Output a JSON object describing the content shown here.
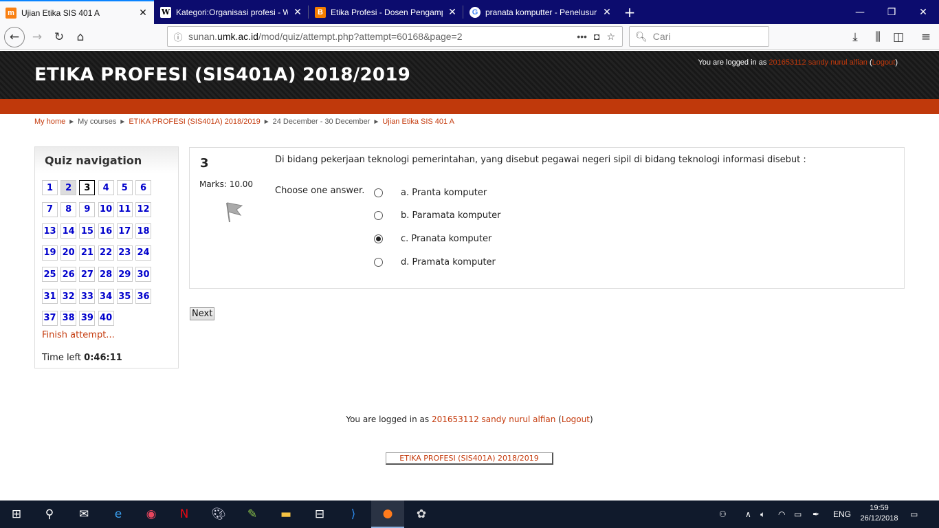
{
  "browser": {
    "tabs": [
      {
        "label": "Ujian Etika SIS 401 A",
        "icon": "moodle-icon"
      },
      {
        "label": "Kategori:Organisasi profesi - W",
        "icon": "wikipedia-icon"
      },
      {
        "label": "Etika Profesi - Dosen Pengamp",
        "icon": "blogger-icon"
      },
      {
        "label": "pranata komputter - Penelusur",
        "icon": "google-icon"
      }
    ],
    "url_prefix": "sunan.",
    "url_domain": "umk.ac.id",
    "url_path": "/mod/quiz/attempt.php?attempt=60168&page=2",
    "search_placeholder": "Cari"
  },
  "header": {
    "course_title": "ETIKA PROFESI (SIS401A) 2018/2019",
    "logged_in_prefix": "You are logged in as",
    "user": "201653112 sandy nurul alfian",
    "logout": "Logout"
  },
  "breadcrumb": {
    "my_home": "My home",
    "my_courses": "My courses",
    "course": "ETIKA PROFESI (SIS401A) 2018/2019",
    "week": "24 December - 30 December",
    "quiz": "Ujian Etika SIS 401 A"
  },
  "quiz_nav": {
    "title": "Quiz navigation",
    "questions": [
      "1",
      "2",
      "3",
      "4",
      "5",
      "6",
      "7",
      "8",
      "9",
      "10",
      "11",
      "12",
      "13",
      "14",
      "15",
      "16",
      "17",
      "18",
      "19",
      "20",
      "21",
      "22",
      "23",
      "24",
      "25",
      "26",
      "27",
      "28",
      "29",
      "30",
      "31",
      "32",
      "33",
      "34",
      "35",
      "36",
      "37",
      "38",
      "39",
      "40"
    ],
    "answered": [
      "2"
    ],
    "current": "3",
    "finish": "Finish attempt...",
    "time_label": "Time left",
    "time_value": "0:46:11"
  },
  "question": {
    "number": "3",
    "marks": "Marks: 10.00",
    "text": "Di bidang pekerjaan teknologi pemerintahan, yang disebut pegawai negeri sipil di bidang teknologi informasi disebut :",
    "prompt": "Choose one answer.",
    "options": [
      {
        "label": "a. Pranta komputer",
        "selected": false
      },
      {
        "label": "b. Paramata komputer",
        "selected": false
      },
      {
        "label": "c. Pranata komputer",
        "selected": true
      },
      {
        "label": "d. Pramata komputer",
        "selected": false
      }
    ],
    "next": "Next"
  },
  "footer": {
    "logged_in_prefix": "You are logged in as",
    "user": "201653112 sandy nurul alfian",
    "logout": "Logout",
    "course_button": "ETIKA PROFESI (SIS401A) 2018/2019"
  },
  "taskbar": {
    "lang": "ENG",
    "time": "19:59",
    "date": "26/12/2018"
  }
}
